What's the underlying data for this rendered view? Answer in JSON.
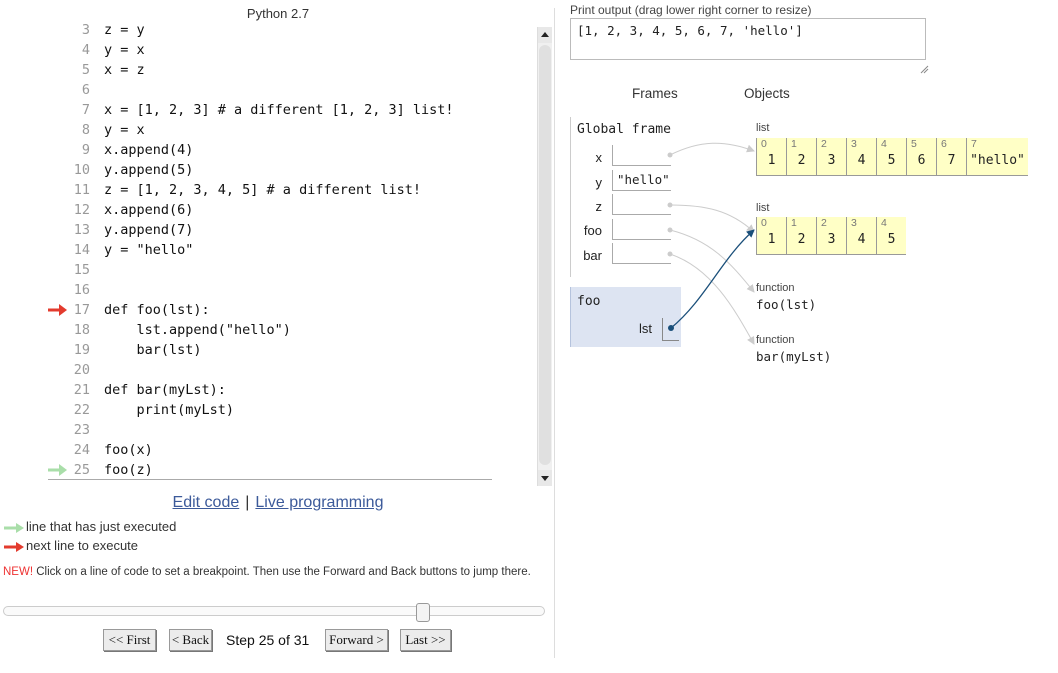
{
  "header": {
    "language": "Python 2.7"
  },
  "code": {
    "lines": [
      {
        "num": "3",
        "text": "z = y"
      },
      {
        "num": "4",
        "text": "y = x"
      },
      {
        "num": "5",
        "text": "x = z"
      },
      {
        "num": "6",
        "text": ""
      },
      {
        "num": "7",
        "text": "x = [1, 2, 3] # a different [1, 2, 3] list!"
      },
      {
        "num": "8",
        "text": "y = x"
      },
      {
        "num": "9",
        "text": "x.append(4)"
      },
      {
        "num": "10",
        "text": "y.append(5)"
      },
      {
        "num": "11",
        "text": "z = [1, 2, 3, 4, 5] # a different list!"
      },
      {
        "num": "12",
        "text": "x.append(6)"
      },
      {
        "num": "13",
        "text": "y.append(7)"
      },
      {
        "num": "14",
        "text": "y = \"hello\""
      },
      {
        "num": "15",
        "text": ""
      },
      {
        "num": "16",
        "text": ""
      },
      {
        "num": "17",
        "text": "def foo(lst):"
      },
      {
        "num": "18",
        "text": "    lst.append(\"hello\")"
      },
      {
        "num": "19",
        "text": "    bar(lst)"
      },
      {
        "num": "20",
        "text": ""
      },
      {
        "num": "21",
        "text": "def bar(myLst):"
      },
      {
        "num": "22",
        "text": "    print(myLst)"
      },
      {
        "num": "23",
        "text": ""
      },
      {
        "num": "24",
        "text": "foo(x)"
      },
      {
        "num": "25",
        "text": "foo(z)"
      }
    ],
    "next_line": "17",
    "just_executed_line": "25"
  },
  "links": {
    "edit_code": "Edit code",
    "separator": "|",
    "live_programming": "Live programming"
  },
  "legend": {
    "just_executed": "line that has just executed",
    "next_to_execute": "next line to execute"
  },
  "note": {
    "badge": "NEW!",
    "text": " Click on a line of code to set a breakpoint. Then use the Forward and Back buttons to jump there."
  },
  "navigation": {
    "first": "<< First",
    "back": "< Back",
    "step_text": "Step 25 of 31",
    "forward": "Forward >",
    "last": "Last >>",
    "slider_position": 0.8
  },
  "output": {
    "label": "Print output (drag lower right corner to resize)",
    "text": "[1, 2, 3, 4, 5, 6, 7, 'hello']"
  },
  "viz": {
    "frames_header": "Frames",
    "objects_header": "Objects",
    "global_frame": {
      "title": "Global frame",
      "vars": [
        {
          "name": "x",
          "value": ""
        },
        {
          "name": "y",
          "value": "\"hello\""
        },
        {
          "name": "z",
          "value": ""
        },
        {
          "name": "foo",
          "value": ""
        },
        {
          "name": "bar",
          "value": ""
        }
      ]
    },
    "foo_frame": {
      "title": "foo",
      "var_name": "lst"
    },
    "objects": {
      "list1": {
        "type": "list",
        "items": [
          {
            "idx": "0",
            "val": "1"
          },
          {
            "idx": "1",
            "val": "2"
          },
          {
            "idx": "2",
            "val": "3"
          },
          {
            "idx": "3",
            "val": "4"
          },
          {
            "idx": "4",
            "val": "5"
          },
          {
            "idx": "5",
            "val": "6"
          },
          {
            "idx": "6",
            "val": "7"
          },
          {
            "idx": "7",
            "val": "\"hello\""
          }
        ]
      },
      "list2": {
        "type": "list",
        "items": [
          {
            "idx": "0",
            "val": "1"
          },
          {
            "idx": "1",
            "val": "2"
          },
          {
            "idx": "2",
            "val": "3"
          },
          {
            "idx": "3",
            "val": "4"
          },
          {
            "idx": "4",
            "val": "5"
          }
        ]
      },
      "func_foo": {
        "type": "function",
        "name": "foo(lst)"
      },
      "func_bar": {
        "type": "function",
        "name": "bar(myLst)"
      }
    }
  },
  "colors": {
    "next_arrow": "#e33b2e",
    "executed_arrow": "#a9dea9",
    "list_bg": "#ffffc6",
    "active_frame_bg": "#dde4f2",
    "pointer_dark": "#1a4f7a",
    "pointer_light": "#cccccc"
  }
}
